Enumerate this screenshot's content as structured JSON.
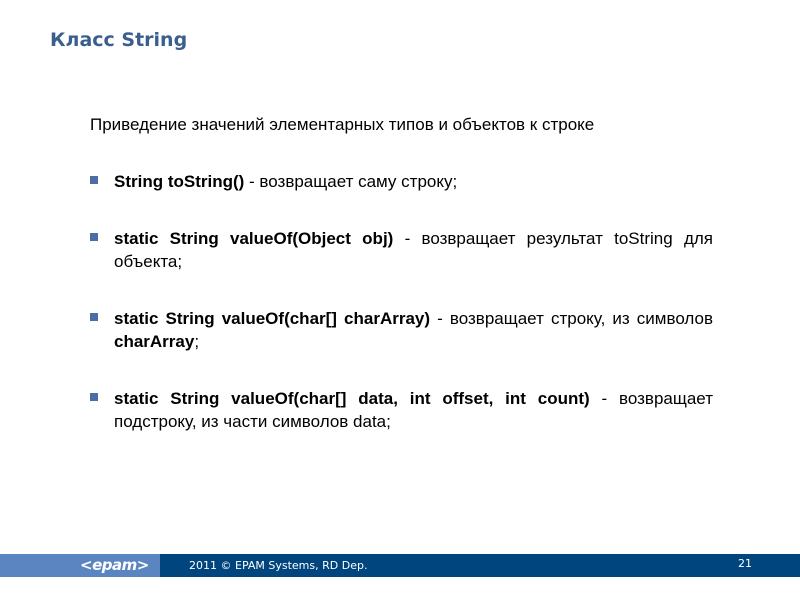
{
  "slide": {
    "title": "Класс String",
    "intro": "Приведение значений элементарных типов и объектов к строке",
    "bullets": [
      {
        "code": "String toString()",
        "text": " - возвращает саму строку;"
      },
      {
        "code": "static String valueOf(Object obj)",
        "text": " - возвращает результат toString для объекта;"
      },
      {
        "code": "static String valueOf(char[] charArray)",
        "text": " - возвращает строку, из символов ",
        "code2": "charArray",
        "text2": ";"
      },
      {
        "code": "static String valueOf(char[] data, int offset, int count)",
        "text": " - возвращает подстроку, из части символов data;"
      }
    ],
    "bullet_icon": "square-bullet-icon"
  },
  "footer": {
    "logo": "<epam>",
    "copyright": "2011 © EPAM Systems, RD Dep.",
    "page_number": "21"
  },
  "colors": {
    "title": "#3a5f8f",
    "bullet": "#4a6fa5",
    "footer_dark": "#00457e",
    "footer_light": "#5b85c0"
  }
}
